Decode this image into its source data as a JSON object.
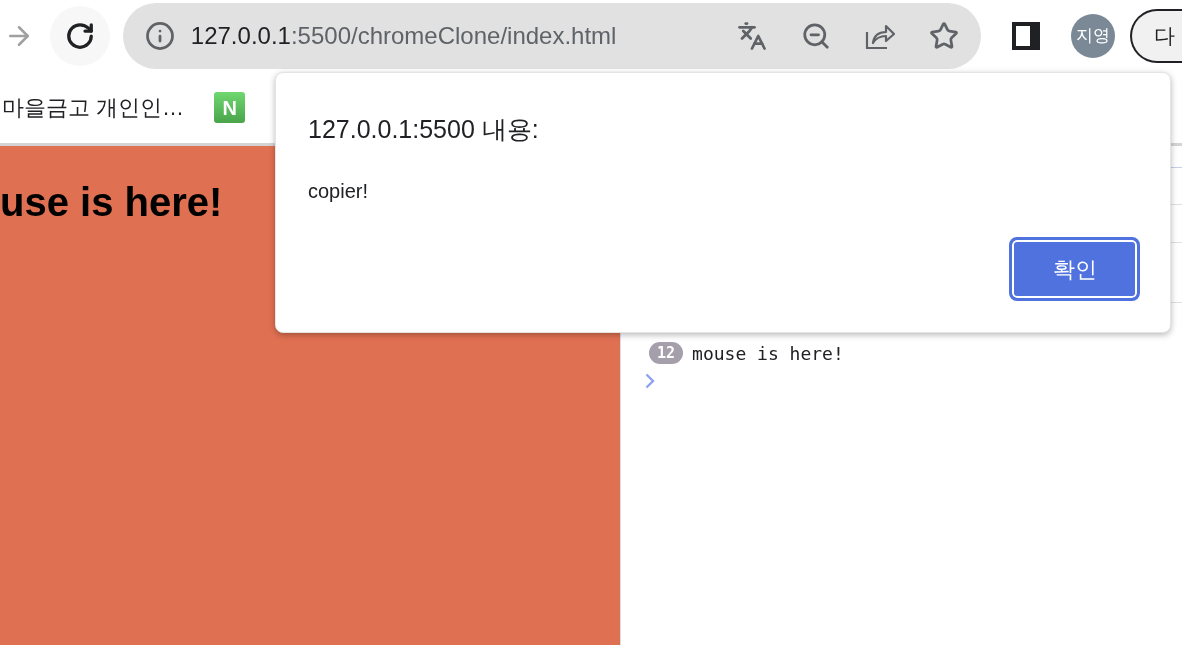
{
  "toolbar": {
    "forward": {
      "disabled": true
    },
    "address": {
      "host": "127.0.0.1",
      "path": ":5500/chromeClone/index.html"
    },
    "profile": {
      "initials": "지영"
    },
    "menu_button": {
      "label": "다"
    }
  },
  "bookmarks": [
    {
      "kind": "text",
      "label": "마을금고 개인인…"
    },
    {
      "kind": "favicon",
      "letter": "N"
    }
  ],
  "page": {
    "heading": "use is here!"
  },
  "console": {
    "messages": [
      {
        "count": "12",
        "text": "mouse is here!"
      }
    ]
  },
  "dialog": {
    "title": "127.0.0.1:5500 내용:",
    "message": "copier!",
    "button": {
      "label": "확인",
      "focused": true
    }
  }
}
